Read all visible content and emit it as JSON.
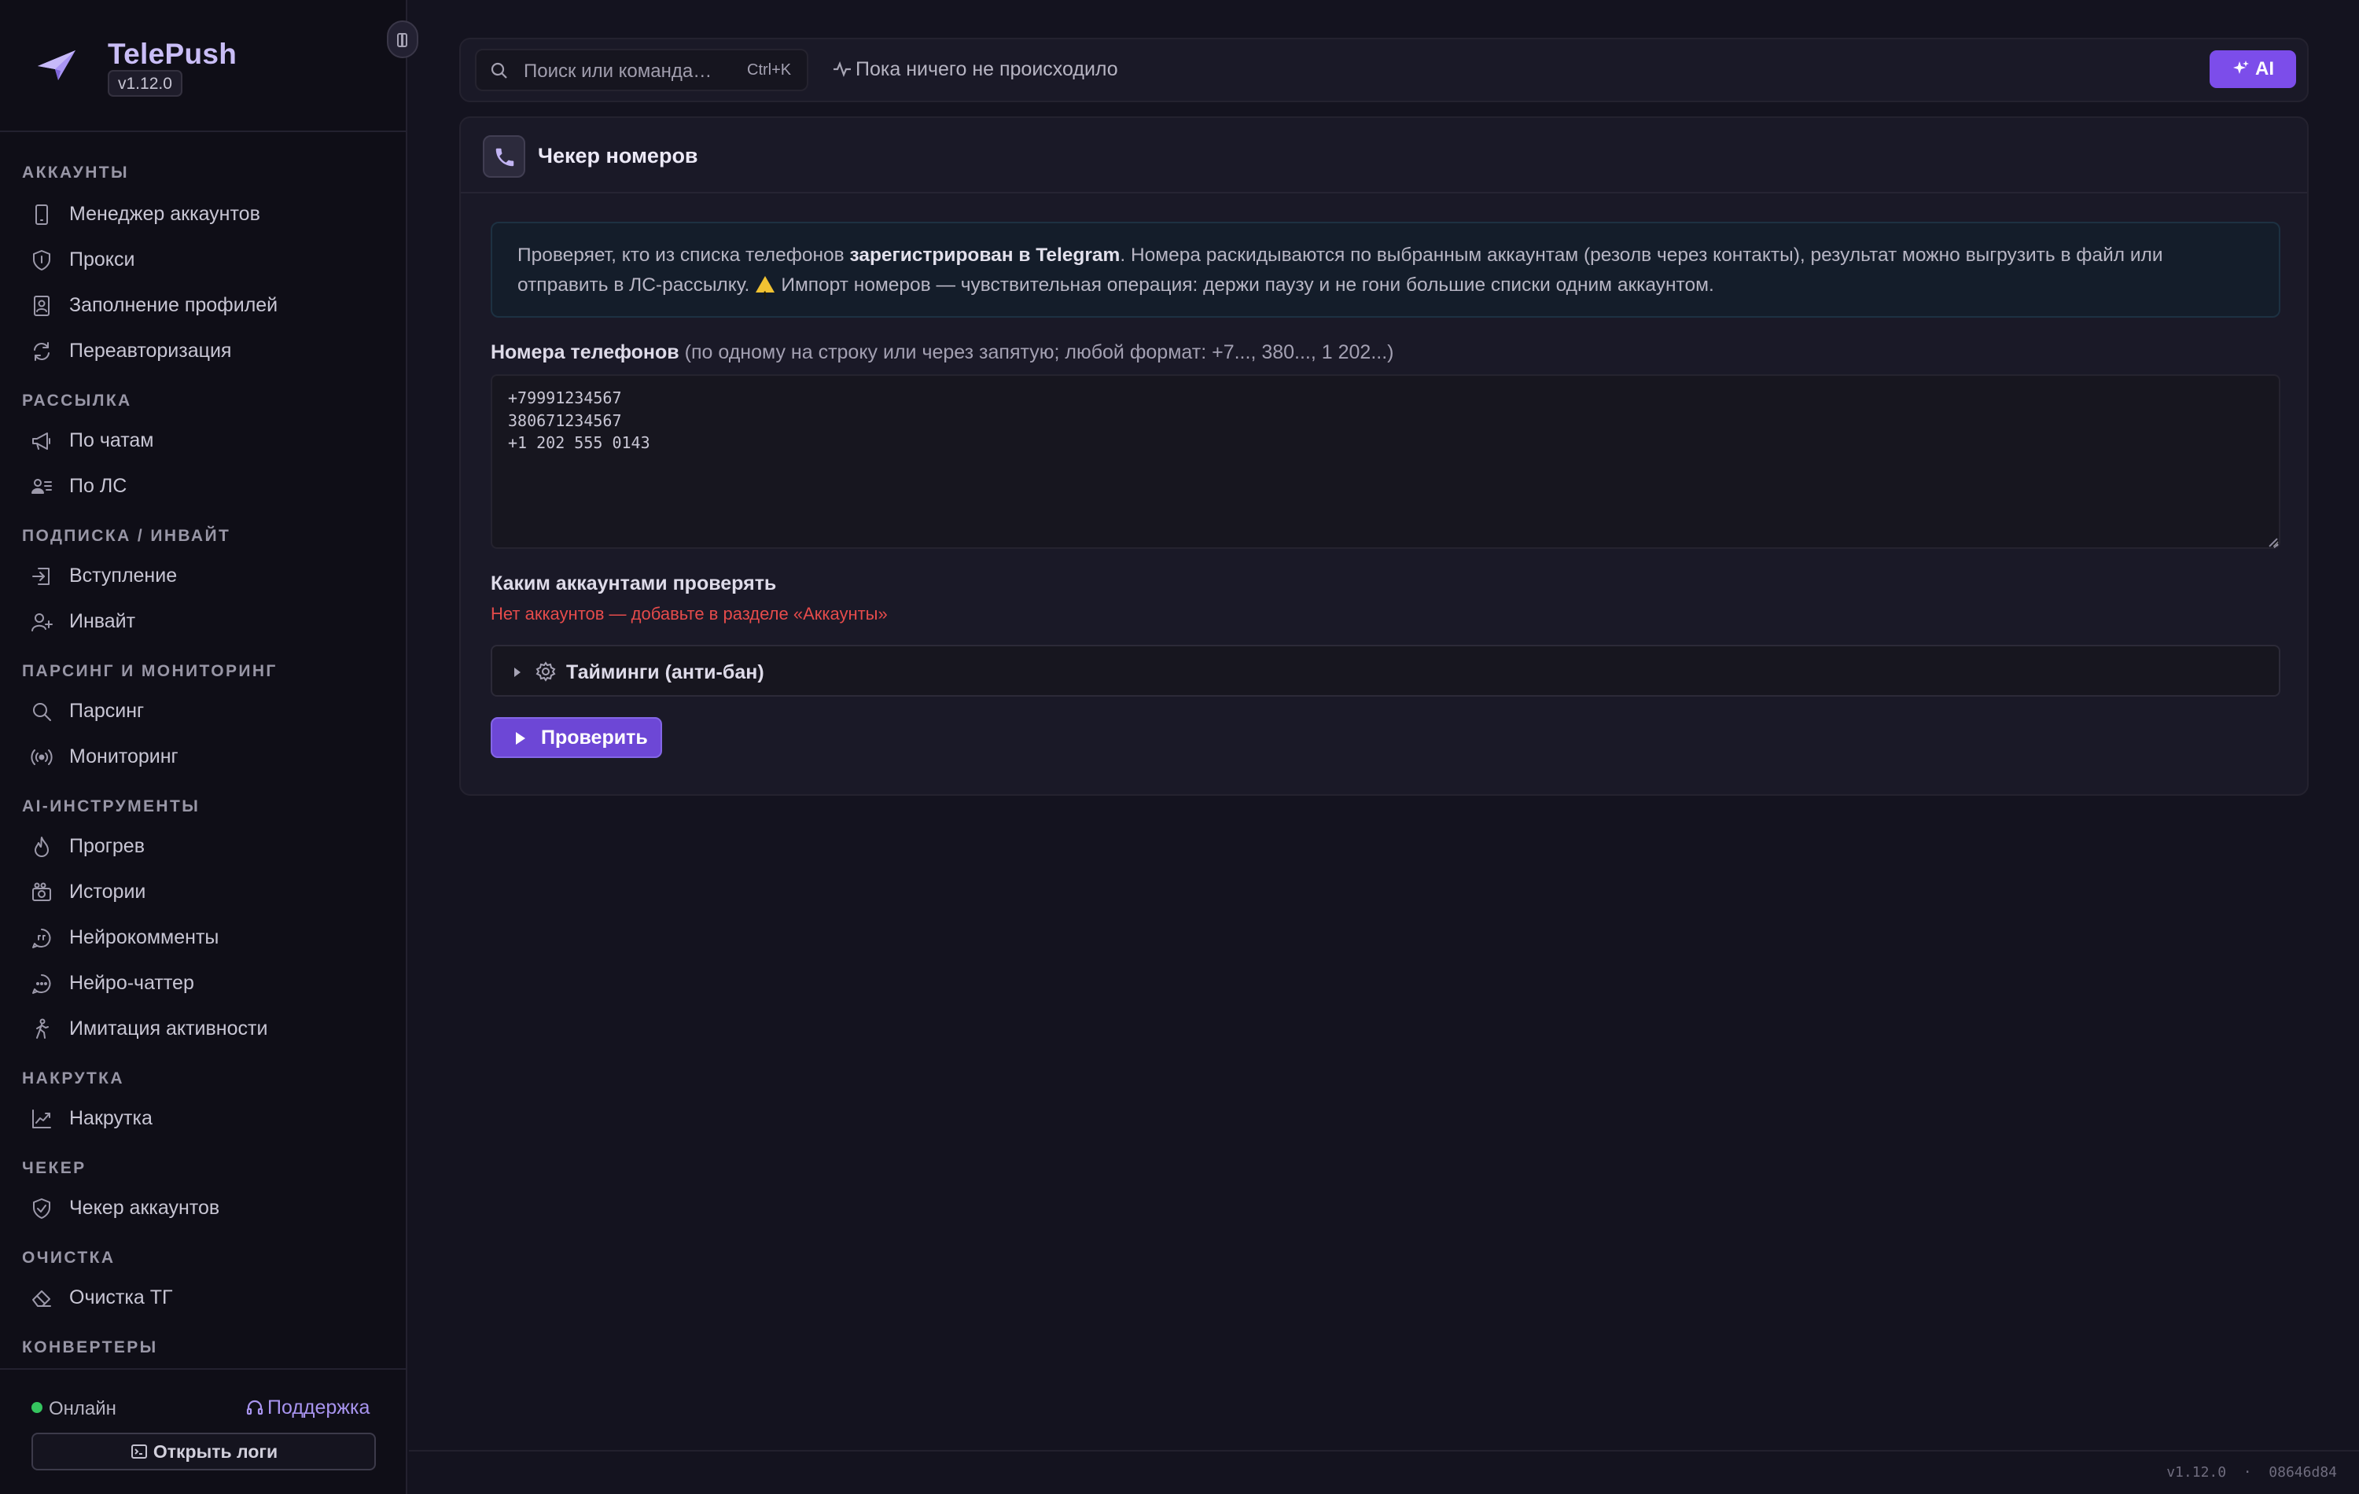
{
  "app": {
    "name": "TelePush",
    "version": "v1.12.0"
  },
  "sidebar": {
    "sections": [
      {
        "title": "Аккаунты",
        "items": [
          {
            "label": "Менеджер аккаунтов",
            "icon": "smartphone-icon"
          },
          {
            "label": "Прокси",
            "icon": "shield-icon"
          },
          {
            "label": "Заполнение профилей",
            "icon": "profile-card-icon"
          },
          {
            "label": "Переавторизация",
            "icon": "refresh-icon"
          }
        ]
      },
      {
        "title": "Рассылка",
        "items": [
          {
            "label": "По чатам",
            "icon": "megaphone-icon"
          },
          {
            "label": "По ЛС",
            "icon": "user-list-icon"
          }
        ]
      },
      {
        "title": "Подписка / Инвайт",
        "items": [
          {
            "label": "Вступление",
            "icon": "login-icon"
          },
          {
            "label": "Инвайт",
            "icon": "user-plus-icon"
          }
        ]
      },
      {
        "title": "Парсинг и мониторинг",
        "items": [
          {
            "label": "Парсинг",
            "icon": "search-icon"
          },
          {
            "label": "Мониторинг",
            "icon": "radio-icon"
          }
        ]
      },
      {
        "title": "AI-инструменты",
        "items": [
          {
            "label": "Прогрев",
            "icon": "flame-icon"
          },
          {
            "label": "Истории",
            "icon": "camera-icon"
          },
          {
            "label": "Нейрокомменты",
            "icon": "quote-bubble-icon"
          },
          {
            "label": "Нейро-чаттер",
            "icon": "chat-bubble-icon"
          },
          {
            "label": "Имитация активности",
            "icon": "walking-icon"
          }
        ]
      },
      {
        "title": "Накрутка",
        "items": [
          {
            "label": "Накрутка",
            "icon": "trending-up-icon"
          }
        ]
      },
      {
        "title": "Чекер",
        "items": [
          {
            "label": "Чекер аккаунтов",
            "icon": "shield-check-icon"
          }
        ]
      },
      {
        "title": "Очистка",
        "items": [
          {
            "label": "Очистка ТГ",
            "icon": "eraser-icon"
          }
        ]
      },
      {
        "title": "Конвертеры",
        "items": []
      }
    ],
    "footer": {
      "status": "Онлайн",
      "status_color": "#35c45f",
      "support": "Поддержка",
      "open_logs": "Открыть логи"
    }
  },
  "topbar": {
    "search_placeholder": "Поиск или команда…",
    "search_shortcut": "Ctrl+K",
    "activity": "Пока ничего не происходило",
    "ai_button": "AI"
  },
  "page": {
    "title": "Чекер номеров",
    "info": {
      "text1": "Проверяет, кто из списка телефонов ",
      "bold": "зарегистрирован в Telegram",
      "text2": ". Номера раскидываются по выбранным аккаунтам (резолв через контакты), результат можно выгрузить в файл или отправить в ЛС-рассылку.",
      "text3": "Импорт номеров — чувствительная операция: держи паузу и не гони большие списки одним аккаунтом."
    },
    "phones_label": "Номера телефонов",
    "phones_hint": "(по одному на строку или через запятую; любой формат: +7..., 380..., 1 202...)",
    "phones_value": "+79991234567\n380671234567\n+1 202 555 0143",
    "accounts_label": "Каким аккаунтами проверять",
    "accounts_empty": "Нет аккаунтов — добавьте в разделе «Аккаунты»",
    "timings_label": "Тайминги (анти-бан)",
    "run_button": "Проверить"
  },
  "statusbar": {
    "version": "v1.12.0",
    "separator": "·",
    "build": "08646d84"
  },
  "colors": {
    "accent": "#7c4dea",
    "error": "#e54b4b",
    "warning": "#f1c232"
  }
}
